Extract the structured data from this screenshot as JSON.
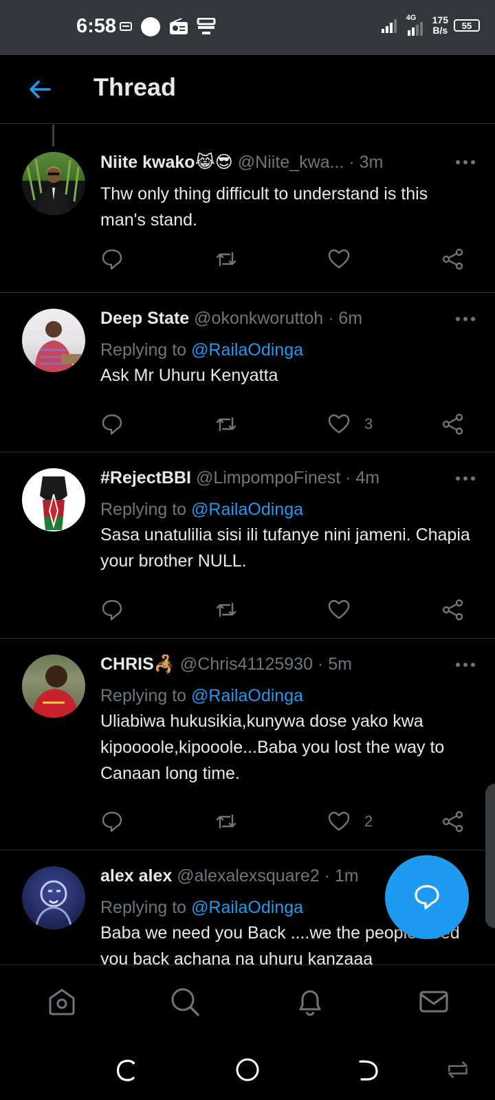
{
  "status_bar": {
    "time": "6:58",
    "net_speed_value": "175",
    "net_speed_unit": "B/s",
    "network_type": "4G",
    "battery": "55"
  },
  "header": {
    "title": "Thread"
  },
  "tweets": [
    {
      "name": "Niite kwako",
      "name_emoji": "😹😎",
      "handle": "@Niite_kwa...",
      "time": "· 3m",
      "replying_prefix": "",
      "replying_to": "",
      "text": "Thw only thing difficult to understand is this man's stand.",
      "likes": ""
    },
    {
      "name": "Deep State",
      "name_emoji": "",
      "handle": "@okonkworuttoh",
      "time": "· 6m",
      "replying_prefix": "Replying to",
      "replying_to": "@RailaOdinga",
      "text": "Ask Mr Uhuru Kenyatta",
      "likes": "3"
    },
    {
      "name": "#RejectBBI",
      "name_emoji": "",
      "handle": "@LimpompoFinest",
      "time": "· 4m",
      "replying_prefix": "Replying to",
      "replying_to": "@RailaOdinga",
      "text": "Sasa unatulilia sisi ili tufanye nini jameni. Chapia your brother NULL.",
      "likes": ""
    },
    {
      "name": "CHRIS",
      "name_emoji": "🦂",
      "handle": "@Chris41125930",
      "time": "· 5m",
      "replying_prefix": "Replying to",
      "replying_to": "@RailaOdinga",
      "text": "Uliabiwa hukusikia,kunywa dose yako kwa kipoooole,kipooole...Baba you lost the way to Canaan long time.",
      "likes": "2"
    },
    {
      "name": "alex alex",
      "name_emoji": "",
      "handle": "@alexalexsquare2",
      "time": "· 1m",
      "replying_prefix": "Replying to",
      "replying_to": "@RailaOdinga",
      "text": "Baba we need you Back ....we the people need you back achana na uhuru kanzaaa",
      "likes": ""
    }
  ],
  "colors": {
    "accent": "#1d9bf0",
    "background": "#000000",
    "secondary_text": "#71767b",
    "divider": "#2f3336",
    "status_bar": "#33363b"
  },
  "icons": {
    "reply": "speech-bubble-icon",
    "retweet": "retweet-icon",
    "like": "heart-icon",
    "share": "share-icon",
    "more": "more-dots-icon",
    "compose": "compose-reply-icon",
    "nav": [
      "home-icon",
      "search-icon",
      "bell-icon",
      "mail-icon"
    ]
  }
}
